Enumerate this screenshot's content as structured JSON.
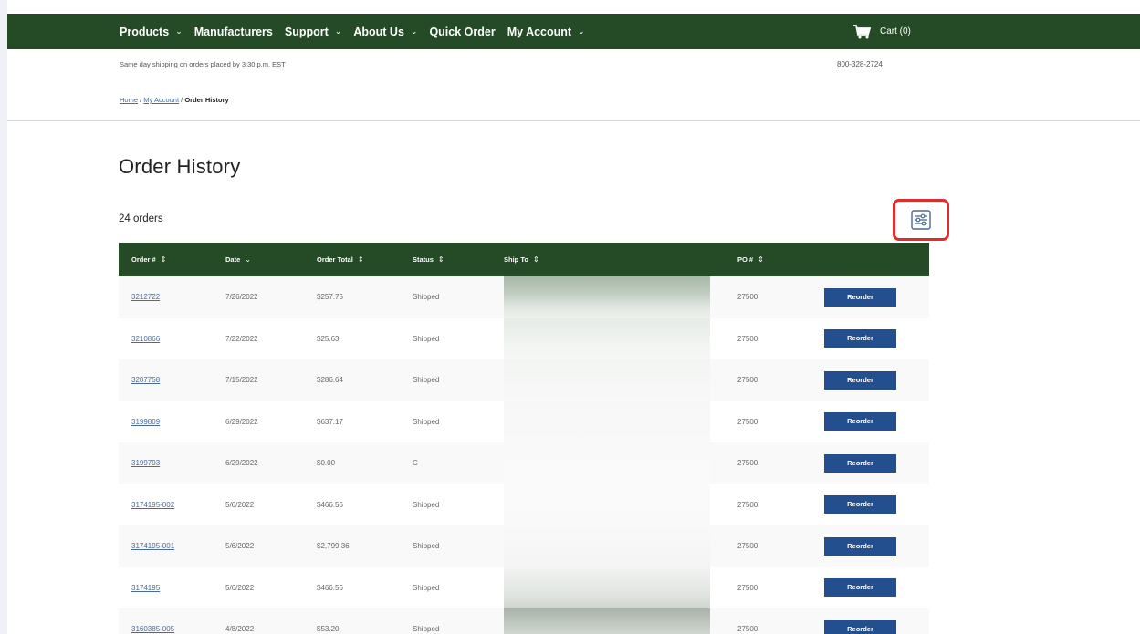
{
  "nav": {
    "items": [
      {
        "label": "Products",
        "has_dropdown": true
      },
      {
        "label": "Manufacturers",
        "has_dropdown": false
      },
      {
        "label": "Support",
        "has_dropdown": true
      },
      {
        "label": "About Us",
        "has_dropdown": true
      },
      {
        "label": "Quick Order",
        "has_dropdown": false
      },
      {
        "label": "My Account",
        "has_dropdown": true
      }
    ],
    "cart_label": "Cart (0)",
    "chevron": "⌄"
  },
  "subheader": {
    "shipping_note": "Same day shipping on orders placed by 3:30 p.m. EST",
    "phone": "800-328-2724"
  },
  "breadcrumb": {
    "home": "Home",
    "sep1": " / ",
    "account": "My Account",
    "sep2": " / ",
    "current": "Order History"
  },
  "page": {
    "title": "Order History",
    "count": "24 orders"
  },
  "table": {
    "headers": {
      "order": "Order #",
      "date": "Date",
      "total": "Order Total",
      "status": "Status",
      "ship_to": "Ship To",
      "po": "PO #",
      "sort_icon": "⇕",
      "date_icon": "⌄"
    },
    "rows": [
      {
        "order": "3212722",
        "date": "7/26/2022",
        "total": "$257.75",
        "status": "Shipped",
        "po": "27500",
        "action": "Reorder"
      },
      {
        "order": "3210866",
        "date": "7/22/2022",
        "total": "$25.63",
        "status": "Shipped",
        "po": "27500",
        "action": "Reorder"
      },
      {
        "order": "3207758",
        "date": "7/15/2022",
        "total": "$286.64",
        "status": "Shipped",
        "po": "27500",
        "action": "Reorder"
      },
      {
        "order": "3199809",
        "date": "6/29/2022",
        "total": "$637.17",
        "status": "Shipped",
        "po": "27500",
        "action": "Reorder"
      },
      {
        "order": "3199793",
        "date": "6/29/2022",
        "total": "$0.00",
        "status": "C",
        "po": "27500",
        "action": "Reorder"
      },
      {
        "order": "3174195-002",
        "date": "5/6/2022",
        "total": "$466.56",
        "status": "Shipped",
        "po": "27500",
        "action": "Reorder"
      },
      {
        "order": "3174195-001",
        "date": "5/6/2022",
        "total": "$2,799.36",
        "status": "Shipped",
        "po": "27500",
        "action": "Reorder"
      },
      {
        "order": "3174195",
        "date": "5/6/2022",
        "total": "$466.56",
        "status": "Shipped",
        "po": "27500",
        "action": "Reorder"
      },
      {
        "order": "3160385-005",
        "date": "4/8/2022",
        "total": "$53.20",
        "status": "Shipped",
        "po": "27500",
        "action": "Reorder"
      }
    ]
  },
  "colors": {
    "brand_green": "#244a26",
    "reorder_blue": "#234f8e",
    "highlight_red": "#e02b2b"
  }
}
